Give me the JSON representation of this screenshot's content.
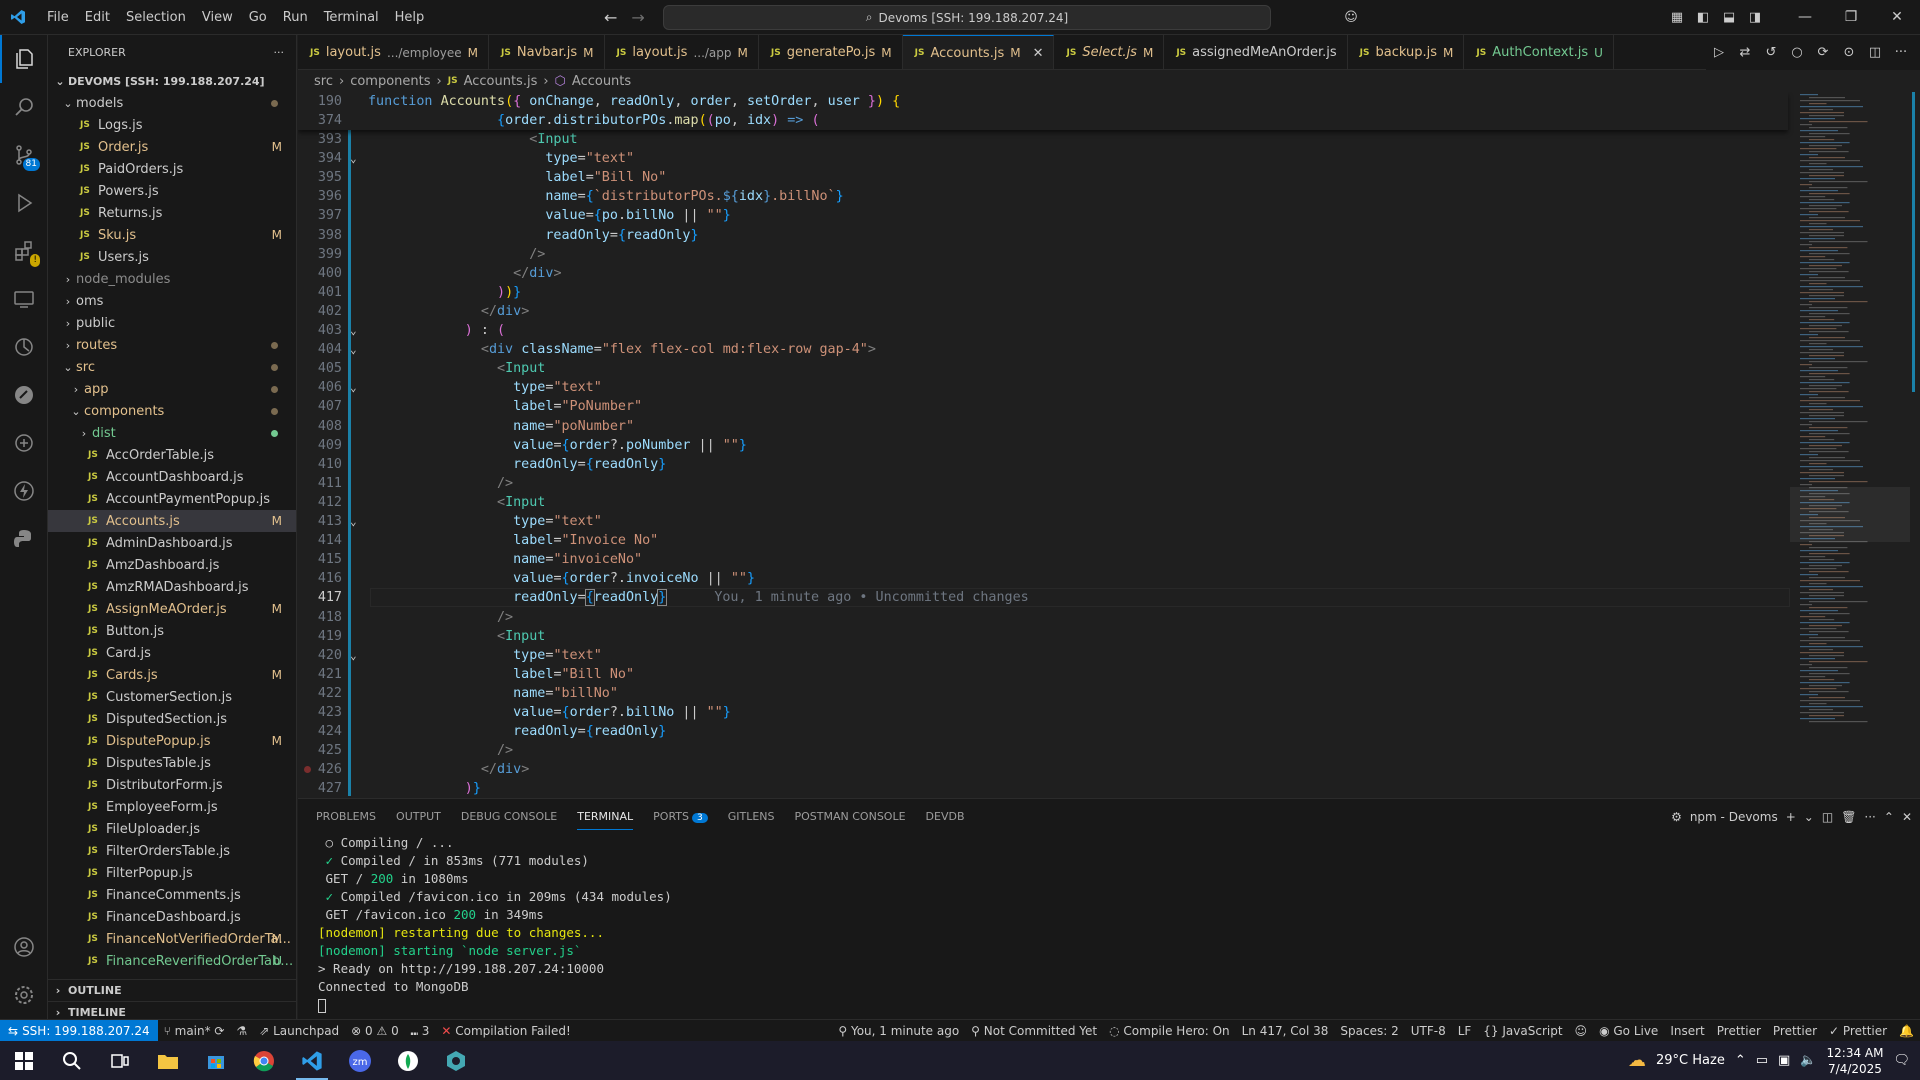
{
  "menu": [
    "File",
    "Edit",
    "Selection",
    "View",
    "Go",
    "Run",
    "Terminal",
    "Help"
  ],
  "command_center": "Devoms [SSH: 199.188.207.24]",
  "explorer": {
    "title": "EXPLORER",
    "root": "DEVOMS [SSH: 199.188.207.24]",
    "items": [
      {
        "label": "models",
        "type": "folder-open",
        "depth": 1,
        "status": "dot"
      },
      {
        "label": "Logs.js",
        "type": "file",
        "depth": 2,
        "status": ""
      },
      {
        "label": "Order.js",
        "type": "file",
        "depth": 2,
        "status": "M"
      },
      {
        "label": "PaidOrders.js",
        "type": "file",
        "depth": 2,
        "status": ""
      },
      {
        "label": "Powers.js",
        "type": "file",
        "depth": 2,
        "status": ""
      },
      {
        "label": "Returns.js",
        "type": "file",
        "depth": 2,
        "status": ""
      },
      {
        "label": "Sku.js",
        "type": "file",
        "depth": 2,
        "status": "M"
      },
      {
        "label": "Users.js",
        "type": "file",
        "depth": 2,
        "status": ""
      },
      {
        "label": "node_modules",
        "type": "folder",
        "depth": 1,
        "status": "",
        "dim": true
      },
      {
        "label": "oms",
        "type": "folder",
        "depth": 1,
        "status": ""
      },
      {
        "label": "public",
        "type": "folder",
        "depth": 1,
        "status": ""
      },
      {
        "label": "routes",
        "type": "folder",
        "depth": 1,
        "status": "dot",
        "modified": true
      },
      {
        "label": "src",
        "type": "folder-open",
        "depth": 1,
        "status": "dot",
        "modified": true
      },
      {
        "label": "app",
        "type": "folder",
        "depth": 2,
        "status": "dot",
        "modified": true
      },
      {
        "label": "components",
        "type": "folder-open",
        "depth": 2,
        "status": "dot",
        "modified": true
      },
      {
        "label": "dist",
        "type": "folder",
        "depth": 3,
        "status": "greendot",
        "untracked": true
      },
      {
        "label": "AccOrderTable.js",
        "type": "file",
        "depth": 3,
        "status": ""
      },
      {
        "label": "AccountDashboard.js",
        "type": "file",
        "depth": 3,
        "status": ""
      },
      {
        "label": "AccountPaymentPopup.js",
        "type": "file",
        "depth": 3,
        "status": ""
      },
      {
        "label": "Accounts.js",
        "type": "file",
        "depth": 3,
        "status": "M",
        "selected": true
      },
      {
        "label": "AdminDashboard.js",
        "type": "file",
        "depth": 3,
        "status": ""
      },
      {
        "label": "AmzDashboard.js",
        "type": "file",
        "depth": 3,
        "status": ""
      },
      {
        "label": "AmzRMADashboard.js",
        "type": "file",
        "depth": 3,
        "status": ""
      },
      {
        "label": "AssignMeAOrder.js",
        "type": "file",
        "depth": 3,
        "status": "M"
      },
      {
        "label": "Button.js",
        "type": "file",
        "depth": 3,
        "status": ""
      },
      {
        "label": "Card.js",
        "type": "file",
        "depth": 3,
        "status": ""
      },
      {
        "label": "Cards.js",
        "type": "file",
        "depth": 3,
        "status": "M"
      },
      {
        "label": "CustomerSection.js",
        "type": "file",
        "depth": 3,
        "status": ""
      },
      {
        "label": "DisputedSection.js",
        "type": "file",
        "depth": 3,
        "status": ""
      },
      {
        "label": "DisputePopup.js",
        "type": "file",
        "depth": 3,
        "status": "M"
      },
      {
        "label": "DisputesTable.js",
        "type": "file",
        "depth": 3,
        "status": ""
      },
      {
        "label": "DistributorForm.js",
        "type": "file",
        "depth": 3,
        "status": ""
      },
      {
        "label": "EmployeeForm.js",
        "type": "file",
        "depth": 3,
        "status": ""
      },
      {
        "label": "FileUploader.js",
        "type": "file",
        "depth": 3,
        "status": ""
      },
      {
        "label": "FilterOrdersTable.js",
        "type": "file",
        "depth": 3,
        "status": ""
      },
      {
        "label": "FilterPopup.js",
        "type": "file",
        "depth": 3,
        "status": ""
      },
      {
        "label": "FinanceComments.js",
        "type": "file",
        "depth": 3,
        "status": ""
      },
      {
        "label": "FinanceDashboard.js",
        "type": "file",
        "depth": 3,
        "status": ""
      },
      {
        "label": "FinanceNotVerifiedOrderTa...",
        "type": "file",
        "depth": 3,
        "status": "M"
      },
      {
        "label": "FinanceReverifiedOrderTabl...",
        "type": "file",
        "depth": 3,
        "status": "U"
      }
    ],
    "outline": "OUTLINE",
    "timeline": "TIMELINE"
  },
  "tabs": [
    {
      "name": "layout.js",
      "desc": ".../employee",
      "status": "M"
    },
    {
      "name": "Navbar.js",
      "desc": "",
      "status": "M"
    },
    {
      "name": "layout.js",
      "desc": ".../app",
      "status": "M"
    },
    {
      "name": "generatePo.js",
      "desc": "",
      "status": "M"
    },
    {
      "name": "Accounts.js",
      "desc": "",
      "status": "M",
      "active": true
    },
    {
      "name": "Select.js",
      "desc": "",
      "status": "M",
      "italic": true
    },
    {
      "name": "assignedMeAnOrder.js",
      "desc": "",
      "status": "",
      "plain": true
    },
    {
      "name": "backup.js",
      "desc": "",
      "status": "M"
    },
    {
      "name": "AuthContext.js",
      "desc": "",
      "status": "U",
      "untracked": true
    }
  ],
  "breadcrumbs": [
    "src",
    "components",
    "Accounts.js",
    "Accounts"
  ],
  "editor": {
    "sticky": [
      {
        "n": "190",
        "html": "<span class=\"kw\">function</span> <span class=\"fn\">Accounts</span><span class=\"br1\">(</span><span class=\"br2\">{</span> <span class=\"var\">onChange</span>, <span class=\"var\">readOnly</span>, <span class=\"var\">order</span>, <span class=\"var\">setOrder</span>, <span class=\"var\">user</span> <span class=\"br2\">}</span><span class=\"br1\">)</span> <span class=\"br1\">{</span>"
      },
      {
        "n": "374",
        "html": "                <span class=\"br3\">{</span><span class=\"var\">order</span>.<span class=\"var\">distributorPOs</span>.<span class=\"fn\">map</span><span class=\"br1\">(</span><span class=\"br2\">(</span><span class=\"var\">po</span>, <span class=\"var\">idx</span><span class=\"br2\">)</span> <span class=\"kw\">=&gt;</span> <span class=\"br2\">(</span>"
      }
    ],
    "lines": [
      {
        "n": "393",
        "html": "                    <span class=\"tagb\">&lt;</span><span class=\"tag\">Input</span>"
      },
      {
        "n": "394",
        "fold": true,
        "html": "                      <span class=\"var\">type</span>=<span class=\"str\">\"text\"</span>"
      },
      {
        "n": "395",
        "html": "                      <span class=\"var\">label</span>=<span class=\"str\">\"Bill No\"</span>"
      },
      {
        "n": "396",
        "html": "                      <span class=\"var\">name</span>=<span class=\"br3\">{</span><span class=\"tmpl\">`distributorPOs.</span><span class=\"kw\">${</span><span class=\"var\">idx</span><span class=\"kw\">}</span><span class=\"tmpl\">.billNo`</span><span class=\"br3\">}</span>"
      },
      {
        "n": "397",
        "html": "                      <span class=\"var\">value</span>=<span class=\"br3\">{</span><span class=\"var\">po</span>.<span class=\"var\">billNo</span> || <span class=\"str\">\"\"</span><span class=\"br3\">}</span>"
      },
      {
        "n": "398",
        "html": "                      <span class=\"var\">readOnly</span>=<span class=\"br3\">{</span><span class=\"var\">readOnly</span><span class=\"br3\">}</span>"
      },
      {
        "n": "399",
        "html": "                    <span class=\"tagb\">/&gt;</span>"
      },
      {
        "n": "400",
        "html": "                  <span class=\"tagb\">&lt;/</span><span class=\"kw\">div</span><span class=\"tagb\">&gt;</span>"
      },
      {
        "n": "401",
        "html": "                <span class=\"br2\">)</span><span class=\"br1\">)</span><span class=\"br3\">}</span>"
      },
      {
        "n": "402",
        "html": "              <span class=\"tagb\">&lt;/</span><span class=\"kw\">div</span><span class=\"tagb\">&gt;</span>"
      },
      {
        "n": "403",
        "fold": true,
        "html": "            <span class=\"br2\">)</span> : <span class=\"br2\">(</span>"
      },
      {
        "n": "404",
        "fold": true,
        "html": "              <span class=\"tagb\">&lt;</span><span class=\"kw\">div</span> <span class=\"var\">className</span>=<span class=\"str\">\"flex flex-col md:flex-row gap-4\"</span><span class=\"tagb\">&gt;</span>"
      },
      {
        "n": "405",
        "html": "                <span class=\"tagb\">&lt;</span><span class=\"tag\">Input</span>"
      },
      {
        "n": "406",
        "fold": true,
        "html": "                  <span class=\"var\">type</span>=<span class=\"str\">\"text\"</span>"
      },
      {
        "n": "407",
        "html": "                  <span class=\"var\">label</span>=<span class=\"str\">\"PoNumber\"</span>"
      },
      {
        "n": "408",
        "html": "                  <span class=\"var\">name</span>=<span class=\"str\">\"poNumber\"</span>"
      },
      {
        "n": "409",
        "html": "                  <span class=\"var\">value</span>=<span class=\"br3\">{</span><span class=\"var\">order</span>?.<span class=\"var\">poNumber</span> || <span class=\"str\">\"\"</span><span class=\"br3\">}</span>"
      },
      {
        "n": "410",
        "html": "                  <span class=\"var\">readOnly</span>=<span class=\"br3\">{</span><span class=\"var\">readOnly</span><span class=\"br3\">}</span>"
      },
      {
        "n": "411",
        "html": "                <span class=\"tagb\">/&gt;</span>"
      },
      {
        "n": "412",
        "html": "                <span class=\"tagb\">&lt;</span><span class=\"tag\">Input</span>"
      },
      {
        "n": "413",
        "fold": true,
        "html": "                  <span class=\"var\">type</span>=<span class=\"str\">\"text\"</span>"
      },
      {
        "n": "414",
        "html": "                  <span class=\"var\">label</span>=<span class=\"str\">\"Invoice No\"</span>"
      },
      {
        "n": "415",
        "html": "                  <span class=\"var\">name</span>=<span class=\"str\">\"invoiceNo\"</span>"
      },
      {
        "n": "416",
        "html": "                  <span class=\"var\">value</span>=<span class=\"br3\">{</span><span class=\"var\">order</span>?.<span class=\"var\">invoiceNo</span> || <span class=\"str\">\"\"</span><span class=\"br3\">}</span>"
      },
      {
        "n": "417",
        "current": true,
        "html": "                  <span class=\"var\">readOnly</span>=<span class=\"br3\" style=\"outline:1px solid #888\">{</span><span class=\"var\">readOnly</span><span class=\"br3\" style=\"outline:1px solid #888\">}</span><span class=\"blame\">You, 1 minute ago • Uncommitted changes</span>"
      },
      {
        "n": "418",
        "html": "                <span class=\"tagb\">/&gt;</span>"
      },
      {
        "n": "419",
        "html": "                <span class=\"tagb\">&lt;</span><span class=\"tag\">Input</span>"
      },
      {
        "n": "420",
        "fold": true,
        "html": "                  <span class=\"var\">type</span>=<span class=\"str\">\"text\"</span>"
      },
      {
        "n": "421",
        "html": "                  <span class=\"var\">label</span>=<span class=\"str\">\"Bill No\"</span>"
      },
      {
        "n": "422",
        "html": "                  <span class=\"var\">name</span>=<span class=\"str\">\"billNo\"</span>"
      },
      {
        "n": "423",
        "html": "                  <span class=\"var\">value</span>=<span class=\"br3\">{</span><span class=\"var\">order</span>?.<span class=\"var\">billNo</span> || <span class=\"str\">\"\"</span><span class=\"br3\">}</span>"
      },
      {
        "n": "424",
        "html": "                  <span class=\"var\">readOnly</span>=<span class=\"br3\">{</span><span class=\"var\">readOnly</span><span class=\"br3\">}</span>"
      },
      {
        "n": "425",
        "html": "                <span class=\"tagb\">/&gt;</span>"
      },
      {
        "n": "426",
        "breakpoint": true,
        "html": "              <span class=\"tagb\">&lt;/</span><span class=\"kw\">div</span><span class=\"tagb\">&gt;</span>"
      },
      {
        "n": "427",
        "html": "            <span class=\"br2\">)</span><span class=\"br3\">}</span>"
      }
    ]
  },
  "panel": {
    "tabs": [
      "PROBLEMS",
      "OUTPUT",
      "DEBUG CONSOLE",
      "TERMINAL",
      "PORTS",
      "GITLENS",
      "POSTMAN CONSOLE",
      "DEVDB"
    ],
    "ports_badge": "3",
    "terminal_name": "npm - Devoms",
    "terminal_lines": [
      {
        "html": " <span>○</span> Compiling / ..."
      },
      {
        "html": " <span class=\"green\">✓</span> Compiled / in 853ms (771 modules)"
      },
      {
        "html": " GET / <span class=\"green\">200</span> in 1080ms"
      },
      {
        "html": " <span class=\"green\">✓</span> Compiled /favicon.ico in 209ms (434 modules)"
      },
      {
        "html": " GET /favicon.ico <span class=\"green\">200</span> in 349ms"
      },
      {
        "html": "<span class=\"yellow\">[nodemon] restarting due to changes...</span>"
      },
      {
        "html": "<span class=\"green\">[nodemon] starting `node server.js`</span>"
      },
      {
        "html": "&gt; Ready on http://199.188.207.24:10000"
      },
      {
        "html": "Connected to MongoDB"
      }
    ]
  },
  "status": {
    "remote": "SSH: 199.188.207.24",
    "branch": "main*",
    "errors": "0",
    "warnings": "0",
    "launchpad": "Launchpad",
    "ports": "3",
    "compile": "Compilation Failed!",
    "blame": "You, 1 minute ago",
    "commit": "Not Committed Yet",
    "hero": "Compile Hero: On",
    "position": "Ln 417, Col 38",
    "spaces": "Spaces: 2",
    "encoding": "UTF-8",
    "eol": "LF",
    "language": "JavaScript",
    "golive": "Go Live",
    "insert": "Insert",
    "prettier1": "Prettier",
    "prettier2": "Prettier",
    "prettier3": "Prettier"
  },
  "taskbar": {
    "weather": "29°C  Haze",
    "time": "12:34 AM",
    "date": "7/4/2025"
  }
}
